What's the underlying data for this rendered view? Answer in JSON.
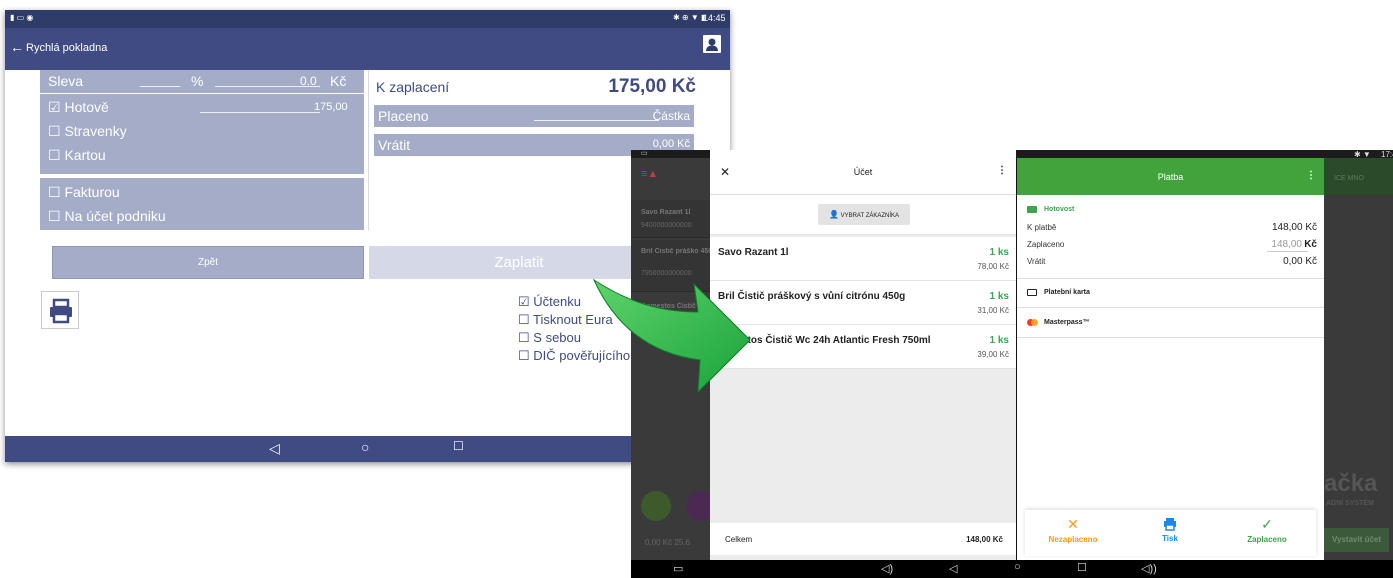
{
  "left": {
    "status_time": "14:45",
    "title": "Rychlá pokladna",
    "payment_methods": {
      "sleva_label": "Sleva",
      "sleva_percent": "%",
      "sleva_value": "0.0",
      "sleva_currency": "Kč",
      "hotove": "Hotově",
      "hotove_value": "175,00",
      "stravenky": "Stravenky",
      "kartou": "Kartou",
      "fakturou": "Fakturou",
      "na_ucet": "Na účet podniku"
    },
    "summary": {
      "k_zaplaceni_label": "K zaplacení",
      "k_zaplaceni_value": "175,00 Kč",
      "placeno_label": "Placeno",
      "placeno_value": "Částka",
      "vratit_label": "Vrátit",
      "vratit_value": "0,00 Kč"
    },
    "buttons": {
      "back": "Zpět",
      "pay": "Zaplatit"
    },
    "print_options": [
      "Účtenku",
      "Tisknout Eura",
      "S sebou",
      "DIČ pověřujícího p"
    ]
  },
  "right": {
    "status_time": "17:4",
    "ucet": {
      "title": "Účet",
      "select_customer": "VYBRAT ZÁKAZNÍKA",
      "items": [
        {
          "name": "Savo Razant 1l",
          "qty": "1 ks",
          "price": "78,00 Kč"
        },
        {
          "name": "Bril Čistič práškový s vůní citrónu 450g",
          "qty": "1 ks",
          "price": "31,00 Kč"
        },
        {
          "name": "stos Čistič Wc 24h Atlantic Fresh 750ml",
          "qty": "1 ks",
          "price": "39,00 Kč"
        }
      ],
      "total_label": "Celkem",
      "total_value": "148,00 Kč"
    },
    "platba": {
      "title": "Platba",
      "hotovost": "Hotovost",
      "k_platbe_label": "K platbě",
      "k_platbe_value": "148,00 Kč",
      "zaplaceno_label": "Zaplaceno",
      "zaplaceno_value": "148,00",
      "zaplaceno_currency": "Kč",
      "vratit_label": "Vrátit",
      "vratit_value": "0,00 Kč",
      "platebni_karta": "Platební karta",
      "masterpass": "Masterpass™",
      "btn_nezaplaceno": "Nezaplaceno",
      "btn_tisk": "Tisk",
      "btn_zaplaceno": "Zaplaceno"
    },
    "background": {
      "items": [
        {
          "name": "Savo Razant 1l",
          "code": "9400000000000"
        },
        {
          "name": "Bril Čistič práško 450g",
          "code": "7950000000000"
        },
        {
          "name": "Domestos Čistič Fresh 750ml",
          "code": ""
        }
      ],
      "vystavit": "Vystavit účet",
      "logo": "ačka",
      "logo_sub": "ADNÍ SYSTÉM",
      "bottom_values": "0,00 Kč  25,6",
      "faded_labels": "ICE  MNO"
    }
  },
  "colors": {
    "navy": "#3f4b82",
    "lavender": "#a4acc8",
    "green": "#42a33d",
    "orange": "#f39c12",
    "blue": "#1e88e5"
  }
}
